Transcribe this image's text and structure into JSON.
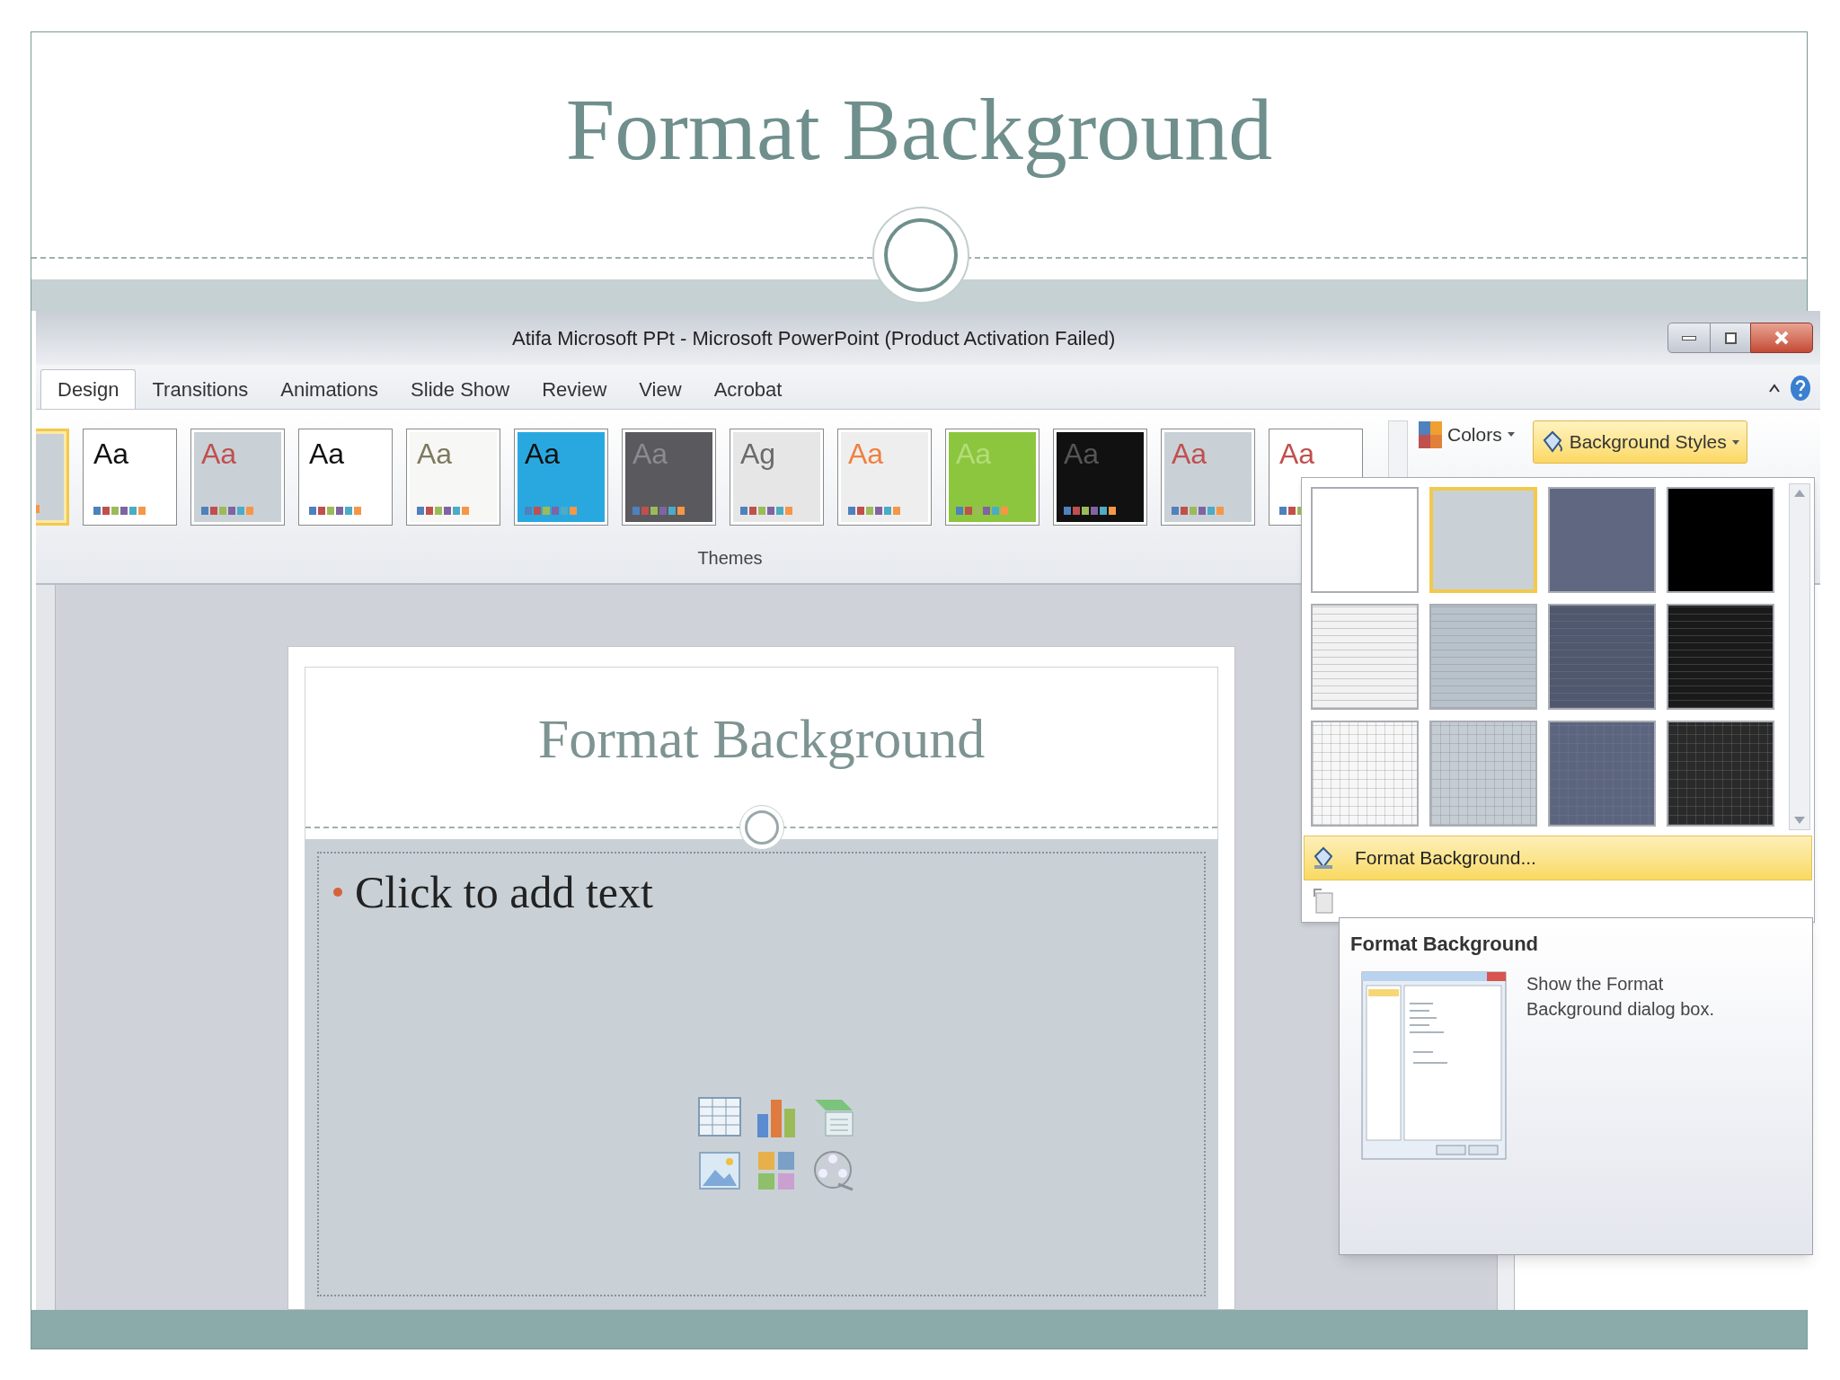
{
  "slide_title": "Format Background",
  "window": {
    "title": "Atifa Microsoft PPt  -  Microsoft PowerPoint (Product Activation Failed)"
  },
  "tabs": [
    {
      "label": "Design",
      "selected": true
    },
    {
      "label": "Transitions",
      "selected": false
    },
    {
      "label": "Animations",
      "selected": false
    },
    {
      "label": "Slide Show",
      "selected": false
    },
    {
      "label": "Review",
      "selected": false
    },
    {
      "label": "View",
      "selected": false
    },
    {
      "label": "Acrobat",
      "selected": false
    }
  ],
  "themes": [
    {
      "selected": true,
      "color": "#c9d1d7"
    },
    {
      "label": "Aa",
      "selected": false,
      "color": "#ffffff"
    },
    {
      "label": "Aa",
      "selected": false,
      "color": "#c9d1d7"
    },
    {
      "label": "Aa",
      "selected": false,
      "color": "#ffffff"
    },
    {
      "label": "Aa",
      "selected": false,
      "color": "#f7f7f5"
    },
    {
      "label": "Aa",
      "selected": false,
      "color": "#29a8e0"
    },
    {
      "label": "Aa",
      "selected": false,
      "color": "#5a5a5e"
    },
    {
      "label": "Ag",
      "selected": false,
      "color": "#e6e6e6"
    },
    {
      "label": "Aa",
      "selected": false,
      "color": "#eeeeee"
    },
    {
      "label": "Aa",
      "selected": false,
      "color": "#8cc63f"
    },
    {
      "label": "Aa",
      "selected": false,
      "color": "#111111"
    },
    {
      "label": "Aa",
      "selected": false,
      "color": "#c9d1d7"
    },
    {
      "label": "Aa",
      "selected": false,
      "color": "#ffffff"
    }
  ],
  "themes_label": "Themes",
  "colors_button": "Colors",
  "background_styles_button": "Background Styles",
  "background_styles": [
    {
      "kind": "plain",
      "color": "#ffffff",
      "selected": false
    },
    {
      "kind": "plain",
      "color": "#c9d1d7",
      "selected": true
    },
    {
      "kind": "plain",
      "color": "#5f6880",
      "selected": false
    },
    {
      "kind": "plain",
      "color": "#000000",
      "selected": false
    },
    {
      "kind": "stripes",
      "color": "#f2f2f2",
      "selected": false
    },
    {
      "kind": "stripes",
      "color": "#b8c2cb",
      "selected": false
    },
    {
      "kind": "stripes",
      "color": "#4f586e",
      "selected": false
    },
    {
      "kind": "stripes",
      "color": "#1a1a1a",
      "selected": false
    },
    {
      "kind": "grid",
      "color": "#f7f7f7",
      "selected": false
    },
    {
      "kind": "grid",
      "color": "#c4ccd4",
      "selected": false
    },
    {
      "kind": "grid",
      "color": "#5c6580",
      "selected": false
    },
    {
      "kind": "grid",
      "color": "#2a2a2a",
      "selected": false
    }
  ],
  "menu_items": [
    {
      "label": "Format Background...",
      "selected": true
    }
  ],
  "tooltip": {
    "title": "Format Background",
    "description": "Show the Format Background dialog box."
  },
  "slide": {
    "title": "Format Background",
    "body": "Click to add text"
  }
}
